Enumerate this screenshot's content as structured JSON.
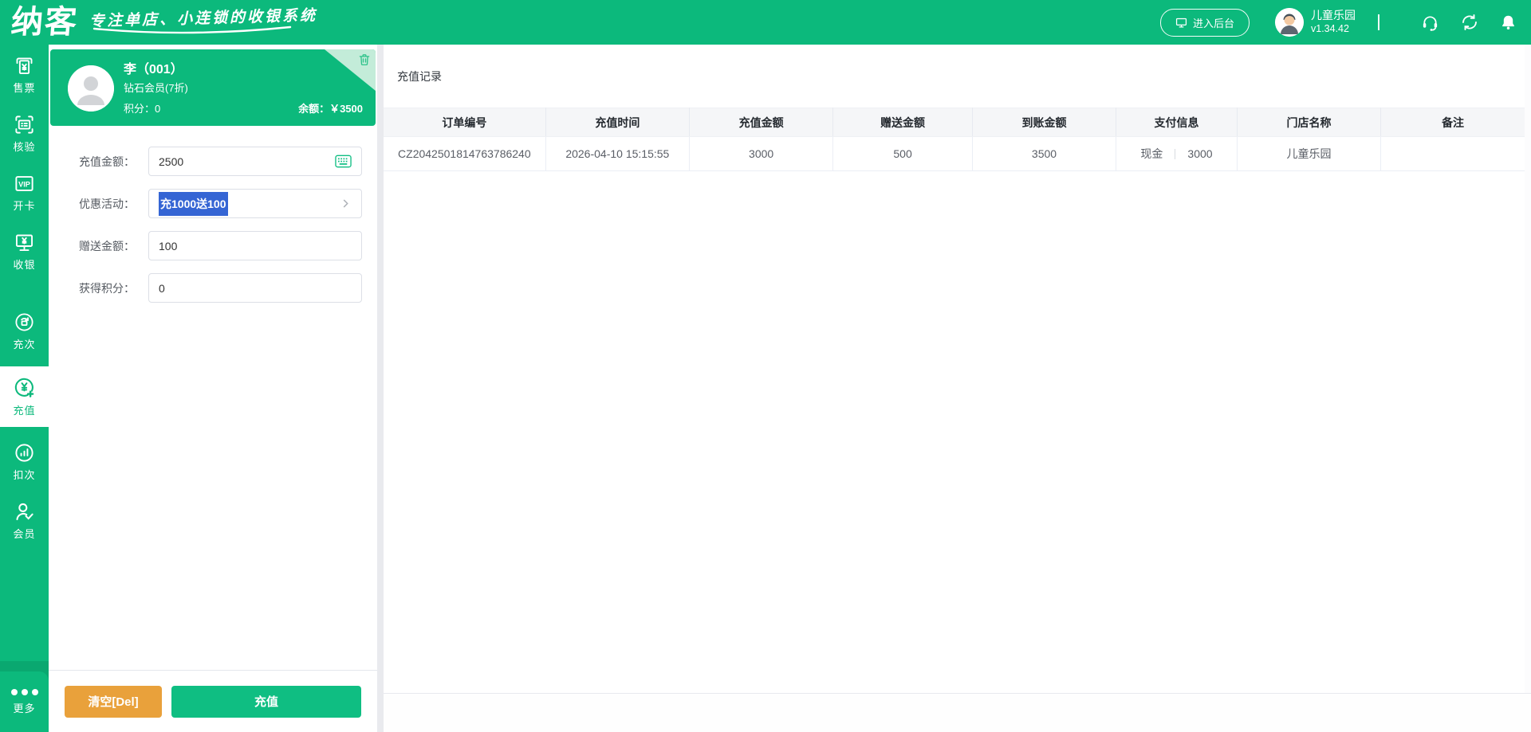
{
  "header": {
    "logo": "纳客",
    "tagline": "专注单店、小连锁的收银系统",
    "backend_button": "进入后台",
    "store_name": "儿童乐园",
    "version": "v1.34.42",
    "icons": [
      "monitor-icon",
      "avatar",
      "headset-icon",
      "sync-icon",
      "bell-icon"
    ]
  },
  "sidebar": {
    "items": [
      {
        "label": "售票",
        "icon": "ticket-icon",
        "selected": false
      },
      {
        "label": "核验",
        "icon": "scan-verify-icon",
        "selected": false
      },
      {
        "label": "开卡",
        "icon": "vip-card-icon",
        "selected": false
      },
      {
        "label": "收银",
        "icon": "cashier-monitor-icon",
        "selected": false
      },
      {
        "label": "充次",
        "icon": "recharge-times-icon",
        "selected": false
      },
      {
        "label": "充值",
        "icon": "recharge-money-icon",
        "selected": true
      },
      {
        "label": "扣次",
        "icon": "deduct-times-icon",
        "selected": false
      },
      {
        "label": "会员",
        "icon": "member-icon",
        "selected": false
      }
    ],
    "more_label": "更多",
    "more_icon": "ellipsis-icon"
  },
  "member_card": {
    "name": "李（001）",
    "level": "钻石会员(7折)",
    "points_label": "积分：",
    "points_value": "0",
    "balance_label": "余额：",
    "balance_value": "￥3500",
    "delete_icon": "trash-icon"
  },
  "form": {
    "fields": [
      {
        "label": "充值金额：",
        "value": "2500",
        "icon": "keyboard-icon"
      },
      {
        "label": "优惠活动：",
        "value": "充1000送100",
        "icon": "chevron-right-icon",
        "text_selected": true
      },
      {
        "label": "赠送金额：",
        "value": "100"
      },
      {
        "label": "获得积分：",
        "value": "0"
      }
    ],
    "clear_button": "清空[Del]",
    "recharge_button": "充值"
  },
  "main": {
    "title": "充值记录",
    "table": {
      "headers": [
        "订单编号",
        "充值时间",
        "充值金额",
        "赠送金额",
        "到账金额",
        "支付信息",
        "门店名称",
        "备注"
      ],
      "rows": [
        {
          "order_no": "CZ2042501814763786240",
          "time": "2026-04-10 15:15:55",
          "amount": "3000",
          "bonus": "500",
          "received": "3500",
          "pay_method": "现金",
          "pay_amount": "3000",
          "store": "儿童乐园",
          "remark": ""
        }
      ]
    }
  },
  "colors": {
    "brand_green": "#0cb97c",
    "button_green": "#0fbe82",
    "button_orange": "#e9a13b",
    "selection_blue": "#3565d4",
    "table_header_bg": "#f5f6f8",
    "border": "#ebeef5"
  }
}
